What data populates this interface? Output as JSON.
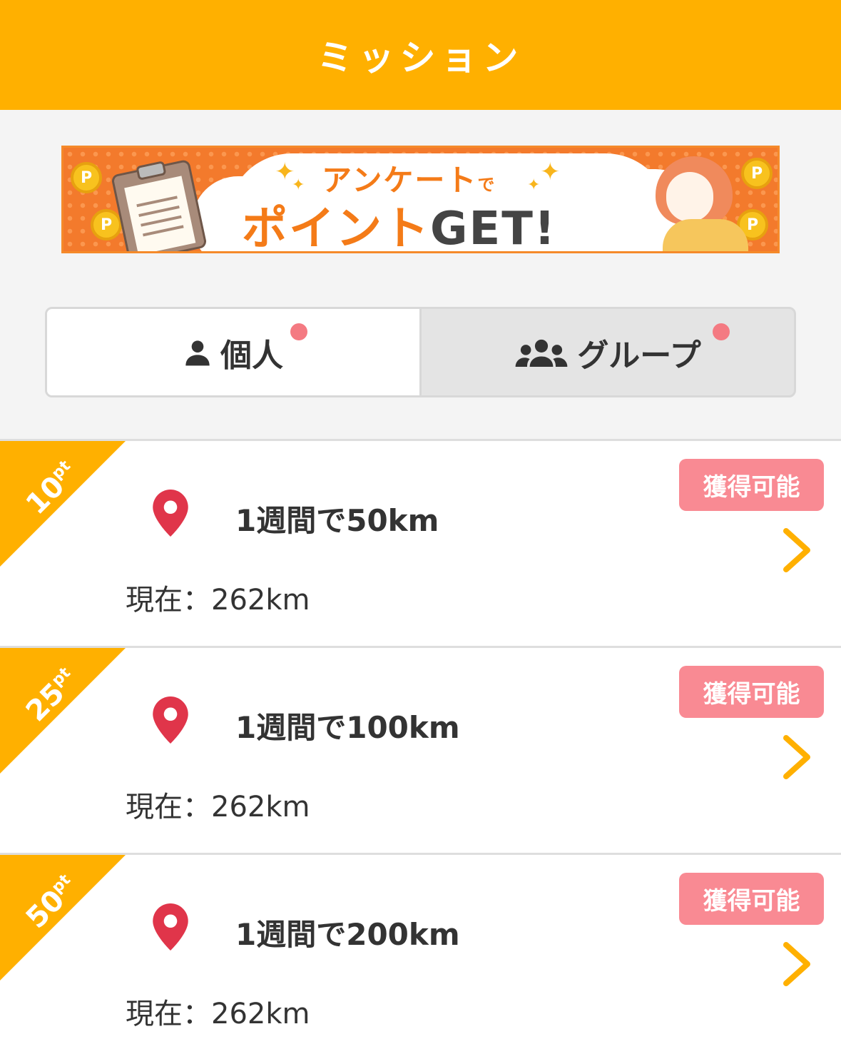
{
  "header": {
    "title": "ミッション"
  },
  "banner": {
    "line1": "アンケート",
    "line1_small": "で",
    "line2_orange": "ポイント",
    "line2_dark": "GET!",
    "coin_label": "P"
  },
  "tabs": [
    {
      "label": "個人",
      "icon": "person-icon",
      "active": true,
      "has_notification": true
    },
    {
      "label": "グループ",
      "icon": "group-icon",
      "active": false,
      "has_notification": true
    }
  ],
  "missions": [
    {
      "points": "10",
      "points_unit": "pt",
      "title": "1週間で50km",
      "current": "現在：262km",
      "badge": "獲得可能"
    },
    {
      "points": "25",
      "points_unit": "pt",
      "title": "1週間で100km",
      "current": "現在：262km",
      "badge": "獲得可能"
    },
    {
      "points": "50",
      "points_unit": "pt",
      "title": "1週間で200km",
      "current": "現在：262km",
      "badge": "獲得可能"
    }
  ],
  "colors": {
    "header": "#ffb000",
    "ribbon": "#ffb000",
    "badge": "#f98a93",
    "pin": "#e0354a",
    "chevron": "#ffb000",
    "notification_dot": "#f47a82"
  }
}
